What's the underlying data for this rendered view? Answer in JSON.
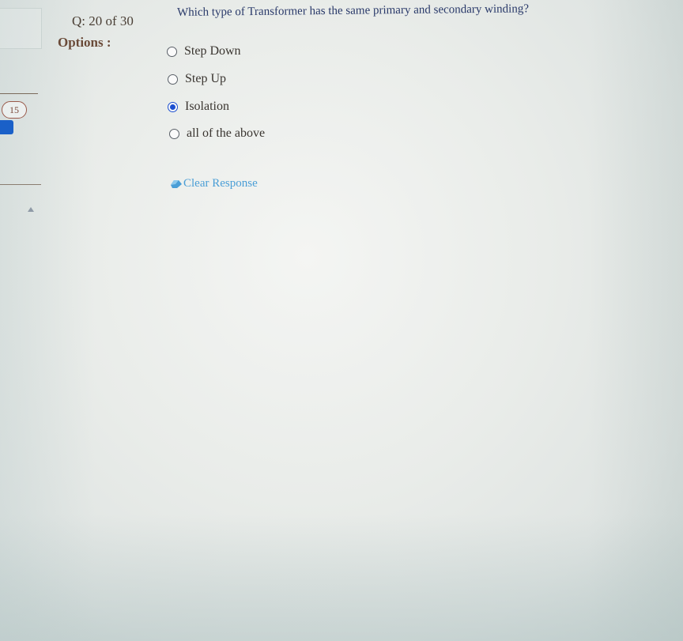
{
  "sidebar": {
    "question_number_badge": "15"
  },
  "question": {
    "counter": "Q: 20 of 30",
    "text": "Which type of Transformer has the same primary and secondary winding?",
    "options_label": "Options :"
  },
  "options": [
    {
      "label": "Step Down",
      "selected": false
    },
    {
      "label": "Step Up",
      "selected": false
    },
    {
      "label": "Isolation",
      "selected": true
    },
    {
      "label": "all of the above",
      "selected": false
    }
  ],
  "actions": {
    "clear_response_label": "Clear Response",
    "clear_icon": "eraser-icon"
  },
  "colors": {
    "selected_radio": "#1c4fd0",
    "clear_link": "#4a9ed6",
    "question_text": "#2a3a6a",
    "options_label": "#6a4a38"
  }
}
